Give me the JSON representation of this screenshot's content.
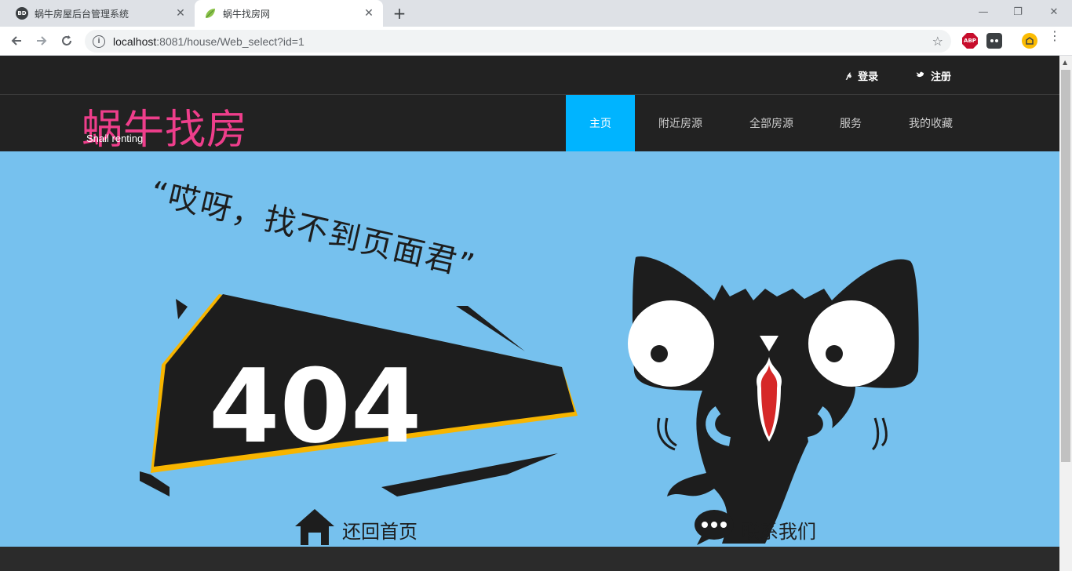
{
  "browser": {
    "tabs": [
      {
        "title": "蜗牛房屋后台管理系统",
        "favicon": "BD"
      },
      {
        "title": "蜗牛找房网",
        "favicon": "leaf-icon"
      }
    ],
    "url_host": "localhost",
    "url_path": ":8081/house/Web_select?id=1",
    "extensions": [
      "ABP"
    ]
  },
  "site": {
    "top_links": [
      {
        "label": "登录",
        "icon": "pinterest-icon"
      },
      {
        "label": "注册",
        "icon": "twitter-icon"
      }
    ],
    "logo": {
      "main": "蜗牛找房",
      "sub": "Snail renting",
      "color": "#ee3e8b"
    },
    "nav": [
      {
        "label": "主页",
        "active": true
      },
      {
        "label": "附近房源",
        "active": false
      },
      {
        "label": "全部房源",
        "active": false
      },
      {
        "label": "服务",
        "active": false
      },
      {
        "label": "我的收藏",
        "active": false
      }
    ],
    "accent": "#00b4ff"
  },
  "error_page": {
    "message": "“哎呀，找不到页面君”",
    "code": "404",
    "actions": [
      {
        "label": "还回首页",
        "icon": "home-icon"
      },
      {
        "label": "联系我们",
        "icon": "chat-bubble-icon"
      }
    ],
    "background": "#76c1ee"
  }
}
